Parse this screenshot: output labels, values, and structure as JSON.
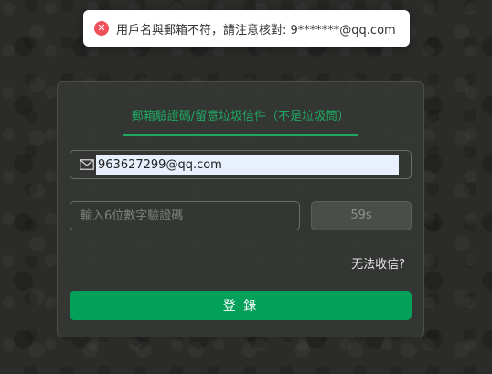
{
  "toast": {
    "icon": "error-icon",
    "icon_glyph": "✕",
    "message": "用戶名與郵箱不符，請注意核對: 9*******@qq.com",
    "color": "#f0505a"
  },
  "login": {
    "tab_label": "郵箱驗證碼/留意垃圾信件（不是垃圾筒）",
    "email_icon": "mail-icon",
    "email_value": "963627299@qq.com",
    "code_placeholder": "輸入6位數字驗證碼",
    "countdown": "59s",
    "help_link": "无法收信?",
    "submit_label": "登 錄",
    "accent_color": "#1fa863",
    "button_color": "#03a05a"
  }
}
